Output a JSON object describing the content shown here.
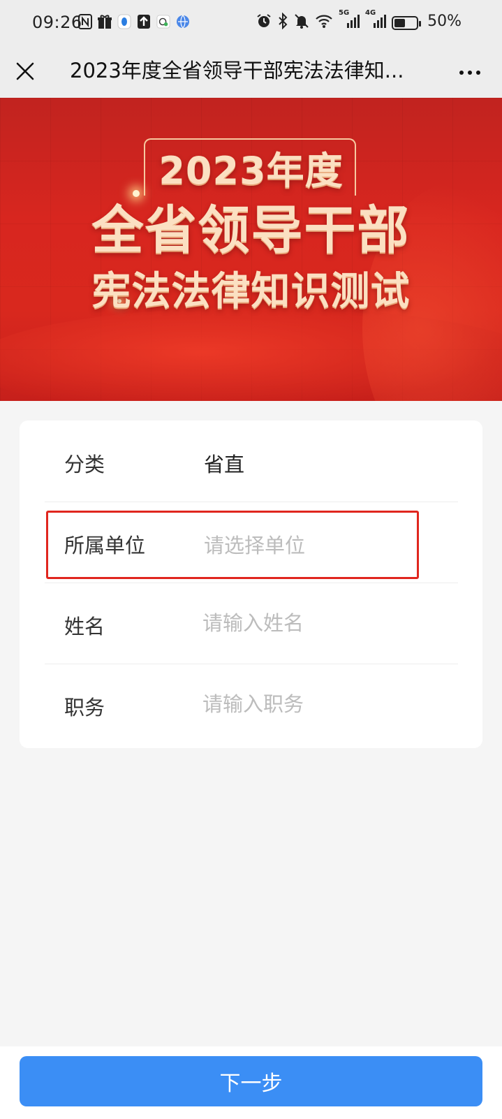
{
  "status_bar": {
    "time": "09:26",
    "battery_percent": "50%",
    "battery_level": 0.5,
    "left_icons": [
      "nfc-icon",
      "gift-icon",
      "app-icon",
      "upload-icon",
      "chat-icon",
      "browser-icon"
    ],
    "right_icons": [
      "alarm-icon",
      "bluetooth-icon",
      "mute-icon",
      "wifi-icon",
      "signal-5g-icon",
      "signal-4g-icon",
      "battery-icon"
    ],
    "network_labels": [
      "5G",
      "4G"
    ]
  },
  "header": {
    "title": "2023年度全省领导干部宪法法律知...",
    "close_icon": "close-icon",
    "more_icon": "more-icon"
  },
  "banner": {
    "line1": "2023年度",
    "line2": "全省领导干部",
    "line3": "宪法法律知识测试"
  },
  "form": {
    "rows": [
      {
        "label": "分类",
        "value": "省直"
      },
      {
        "label": "所属单位",
        "placeholder": "请选择单位"
      },
      {
        "label": "姓名",
        "placeholder": "请输入姓名"
      },
      {
        "label": "职务",
        "placeholder": "请输入职务"
      }
    ]
  },
  "footer": {
    "next_label": "下一步"
  },
  "colors": {
    "accent": "#3b8ef5",
    "banner_red": "#d8261f",
    "highlight": "#e0261e"
  }
}
